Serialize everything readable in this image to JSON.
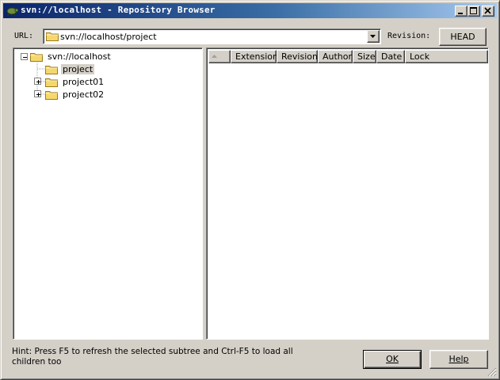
{
  "window": {
    "title": "svn://localhost - Repository Browser"
  },
  "toolbar": {
    "url_label": "URL:",
    "url_value": "svn://localhost/project",
    "revision_label": "Revision:",
    "revision_button": "HEAD"
  },
  "tree": {
    "root": "svn://localhost",
    "children": [
      {
        "label": "project",
        "selected": true,
        "expandable": false
      },
      {
        "label": "project01",
        "selected": false,
        "expandable": true
      },
      {
        "label": "project02",
        "selected": false,
        "expandable": true
      }
    ]
  },
  "list": {
    "columns": [
      "Extension",
      "Revision",
      "Author",
      "Size",
      "Date",
      "Lock"
    ],
    "rows": []
  },
  "footer": {
    "hint": "Hint: Press F5 to refresh the selected subtree and Ctrl-F5 to load all children too",
    "ok_label": "OK",
    "help_label": "Help"
  },
  "colors": {
    "titlebar_start": "#0a246a",
    "titlebar_end": "#a6caf0",
    "face": "#d4d0c8",
    "folder": "#f5d76e"
  }
}
